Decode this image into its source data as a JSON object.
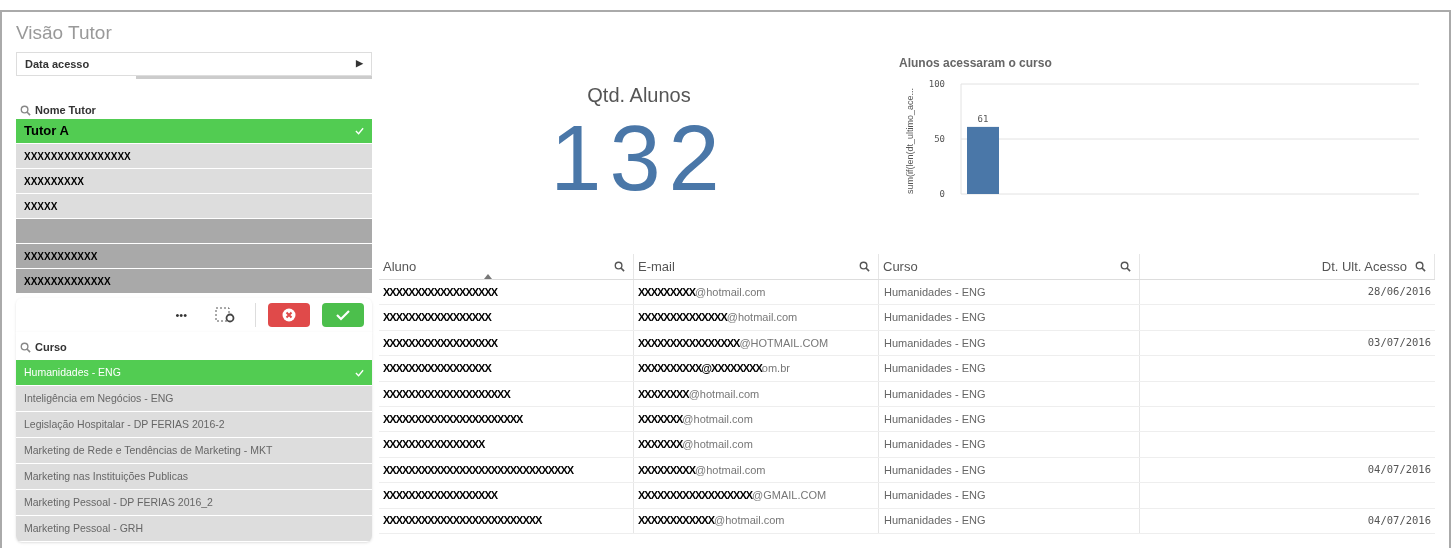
{
  "title": "Visão Tutor",
  "date_filter": {
    "label": "Data acesso",
    "arrow": "▶"
  },
  "tutor_list": {
    "title": "Nome Tutor",
    "items": [
      {
        "label": "Tutor A",
        "selected": true,
        "excluded": false
      },
      {
        "label": "XXXXXXXXXXXXXXXX",
        "selected": false,
        "excluded": false
      },
      {
        "label": "XXXXXXXXX",
        "selected": false,
        "excluded": false
      },
      {
        "label": "XXXXX",
        "selected": false,
        "excluded": false
      },
      {
        "selected": false,
        "excluded": true
      },
      {
        "label": "XXXXXXXXXXX",
        "selected": false,
        "excluded": true
      },
      {
        "label": "XXXXXXXXXXXXX",
        "selected": false,
        "excluded": true
      }
    ]
  },
  "selection_toolbar": {
    "more": "•••"
  },
  "course_list": {
    "title": "Curso",
    "items": [
      {
        "label": "Humanidades - ENG",
        "selected": true
      },
      {
        "label": "Inteligência em Negócios - ENG",
        "selected": false
      },
      {
        "label": "Legislação Hospitalar - DP FERIAS 2016-2",
        "selected": false
      },
      {
        "label": "Marketing de Rede e Tendências de Marketing - MKT",
        "selected": false
      },
      {
        "label": "Marketing nas Instituições Publicas",
        "selected": false
      },
      {
        "label": "Marketing Pessoal - DP FERIAS 2016_2",
        "selected": false
      },
      {
        "label": "Marketing Pessoal - GRH",
        "selected": false
      }
    ]
  },
  "kpi": {
    "label": "Qtd. Alunos",
    "value": "132"
  },
  "chart": {
    "title": "Alunos acessaram o curso",
    "chart_data": {
      "type": "bar",
      "ylabel": "sum(if(len(dt_ultimo_ace...",
      "values": [
        61
      ],
      "ylim": [
        0,
        100
      ],
      "yticks": [
        0,
        50,
        100
      ],
      "data_labels": true,
      "color": "#4a77a8"
    }
  },
  "table": {
    "columns": [
      {
        "label": "Aluno",
        "sorted": true
      },
      {
        "label": "E-mail",
        "sorted": false
      },
      {
        "label": "Curso",
        "sorted": false
      },
      {
        "label": "Dt. Ult. Acesso",
        "sorted": false
      }
    ],
    "rows": [
      {
        "aluno": "XXXXXXXXXXXXXXXXXX",
        "email_user": "XXXXXXXXX",
        "email_domain": "@hotmail.com",
        "curso": "Humanidades - ENG",
        "dt": "28/06/2016"
      },
      {
        "aluno": "XXXXXXXXXXXXXXXXX",
        "email_user": "XXXXXXXXXXXXXX",
        "email_domain": "@hotmail.com",
        "curso": "Humanidades - ENG"
      },
      {
        "aluno": "XXXXXXXXXXXXXXXXXX",
        "email_user": "XXXXXXXXXXXXXXXX",
        "email_domain": "@HOTMAIL.COM",
        "curso": "Humanidades - ENG",
        "dt": "03/07/2016"
      },
      {
        "aluno": "XXXXXXXXXXXXXXXXX",
        "email_user": "XXXXXXXXXX@XXXXXXXX",
        "email_domain": "om.br",
        "curso": "Humanidades - ENG"
      },
      {
        "aluno": "XXXXXXXXXXXXXXXXXXXX",
        "email_user": "XXXXXXXX",
        "email_domain": "@hotmail.com",
        "curso": "Humanidades - ENG"
      },
      {
        "aluno": "XXXXXXXXXXXXXXXXXXXXXX",
        "email_user": "XXXXXXX",
        "email_domain": "@hotmail.com",
        "curso": "Humanidades - ENG"
      },
      {
        "aluno": "XXXXXXXXXXXXXXXX",
        "email_user": "XXXXXXX",
        "email_domain": "@hotmail.com",
        "curso": "Humanidades - ENG"
      },
      {
        "aluno": "XXXXXXXXXXXXXXXXXXXXXXXXXXXXXX",
        "email_user": "XXXXXXXXX",
        "email_domain": "@hotmail.com",
        "curso": "Humanidades - ENG",
        "dt": "04/07/2016"
      },
      {
        "aluno": "XXXXXXXXXXXXXXXXXX",
        "email_user": "XXXXXXXXXXXXXXXXXX",
        "email_domain": "@GMAIL.COM",
        "curso": "Humanidades - ENG"
      },
      {
        "aluno": "XXXXXXXXXXXXXXXXXXXXXXXXX",
        "email_user": "XXXXXXXXXXXX",
        "email_domain": "@hotmail.com",
        "curso": "Humanidades - ENG",
        "dt": "04/07/2016"
      }
    ]
  }
}
